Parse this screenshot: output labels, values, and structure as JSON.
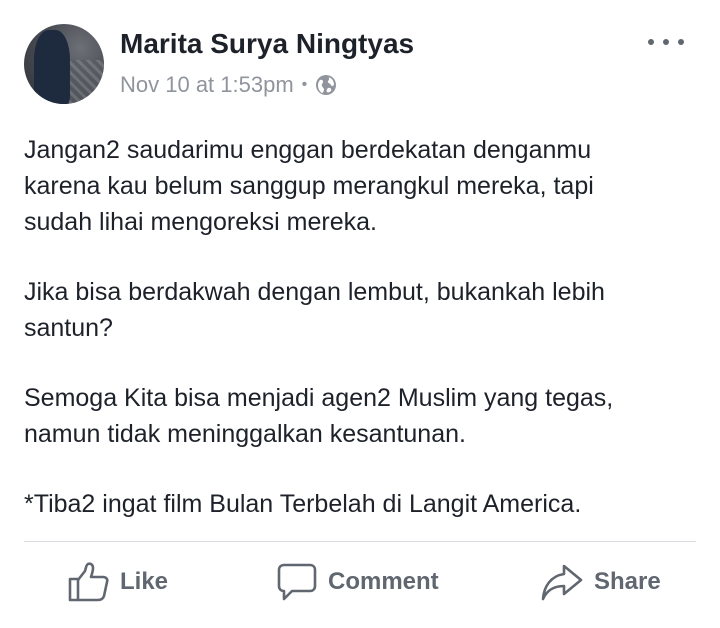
{
  "post": {
    "author_name": "Marita Surya Ningtyas",
    "timestamp": "Nov 10 at 1:53pm",
    "separator": "•",
    "privacy_icon": "globe-icon",
    "more_icon": "more-options-icon",
    "paragraphs": [
      "Jangan2 saudarimu enggan berdekatan denganmu\nkarena kau belum sanggup merangkul mereka, tapi\nsudah lihai mengoreksi mereka.",
      "Jika bisa berdakwah dengan lembut, bukankah lebih\nsantun?",
      "Semoga Kita bisa menjadi agen2 Muslim yang tegas,\nnamun tidak meninggalkan kesantunan.",
      "*Tiba2 ingat film Bulan Terbelah di Langit America."
    ]
  },
  "actions": {
    "like_label": "Like",
    "comment_label": "Comment",
    "share_label": "Share"
  },
  "colors": {
    "text": "#1d2129",
    "secondary": "#90949c",
    "action": "#606770",
    "divider": "#dadde1"
  }
}
